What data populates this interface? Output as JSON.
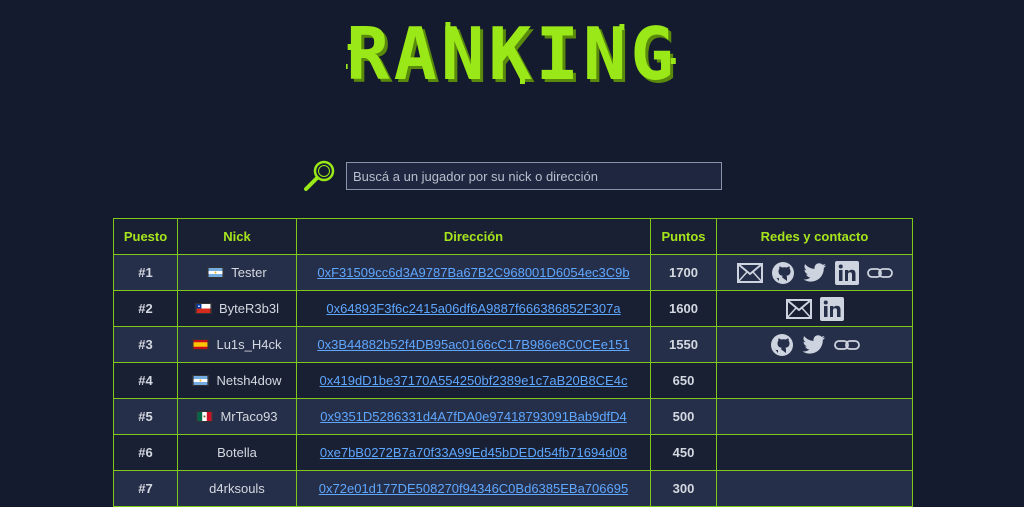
{
  "header": {
    "title": "RANKING"
  },
  "search": {
    "placeholder": "Buscá a un jugador por su nick o dirección"
  },
  "table": {
    "headers": {
      "rank": "Puesto",
      "nick": "Nick",
      "address": "Dirección",
      "points": "Puntos",
      "socials": "Redes y contacto"
    },
    "rows": [
      {
        "rank": "#1",
        "flag": "argentina",
        "nick": "Tester",
        "address": "0xF31509cc6d3A9787Ba67B2C968001D6054ec3C9b",
        "points": "1700",
        "socials": [
          "email",
          "github",
          "twitter",
          "linkedin",
          "link"
        ]
      },
      {
        "rank": "#2",
        "flag": "chile",
        "nick": "ByteR3b3l",
        "address": "0x64893F3f6c2415a06df6A9887f666386852F307a",
        "points": "1600",
        "socials": [
          "email",
          "linkedin"
        ]
      },
      {
        "rank": "#3",
        "flag": "spain",
        "nick": "Lu1s_H4ck",
        "address": "0x3B44882b52f4DB95ac0166cC17B986e8C0CEe151",
        "points": "1550",
        "socials": [
          "github",
          "twitter",
          "link"
        ]
      },
      {
        "rank": "#4",
        "flag": "argentina",
        "nick": "Netsh4dow",
        "address": "0x419dD1be37170A554250bf2389e1c7aB20B8CE4c",
        "points": "650",
        "socials": []
      },
      {
        "rank": "#5",
        "flag": "mexico",
        "nick": "MrTaco93",
        "address": "0x9351D5286331d4A7fDA0e97418793091Bab9dfD4",
        "points": "500",
        "socials": []
      },
      {
        "rank": "#6",
        "flag": "",
        "nick": "Botella",
        "address": "0xe7bB0272B7a70f33A99Ed45bDEDd54fb71694d08",
        "points": "450",
        "socials": []
      },
      {
        "rank": "#7",
        "flag": "",
        "nick": "d4rksouls",
        "address": "0x72e01d177DE508270f94346C0Bd6385EBa706695",
        "points": "300",
        "socials": []
      }
    ]
  },
  "colors": {
    "background": "#151b2e",
    "accent": "#9ae817",
    "border": "#7fc719",
    "link": "#5ea7ff",
    "row_alt": "#262f4a"
  }
}
